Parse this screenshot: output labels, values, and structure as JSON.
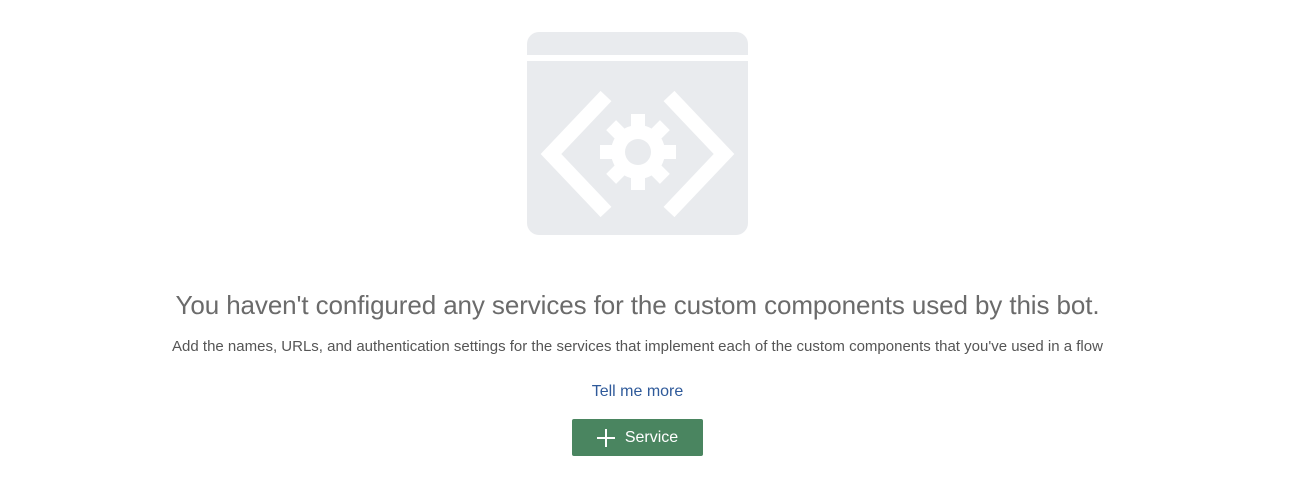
{
  "empty_state": {
    "illustration_icon": "code-gear-window-icon",
    "headline": "You haven't configured any services for the custom components used by this bot.",
    "description": "Add the names, URLs, and authentication settings for the services that implement each of the custom components that you've used in a flow",
    "link_label": "Tell me more",
    "button": {
      "icon": "plus-icon",
      "label": "Service"
    }
  },
  "colors": {
    "illustration_bg": "#e9ebee",
    "headline_text": "#6b6b6b",
    "link": "#2f5a9a",
    "button_bg": "#4a8560",
    "button_text": "#ffffff"
  }
}
